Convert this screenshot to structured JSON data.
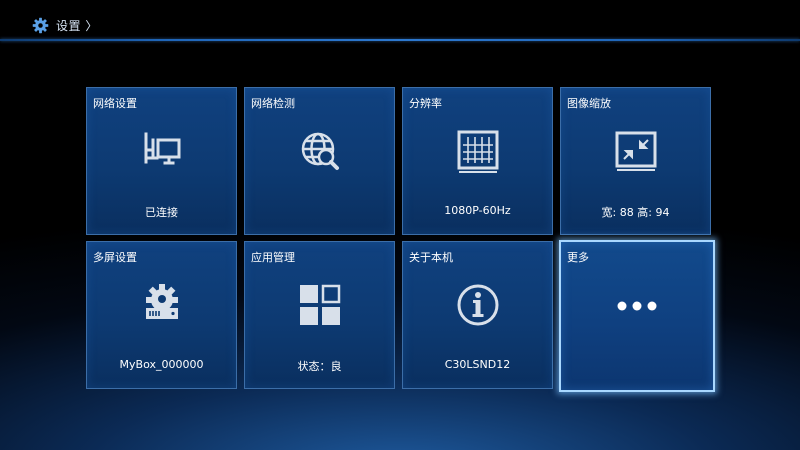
{
  "header": {
    "title": "设置 〉",
    "icon": "gear-icon"
  },
  "tiles": [
    {
      "title": "网络设置",
      "status": "已连接",
      "icon": "ethernet-network-icon"
    },
    {
      "title": "网络检测",
      "status": "",
      "icon": "globe-search-icon"
    },
    {
      "title": "分辨率",
      "status": "1080P-60Hz",
      "icon": "resolution-grid-icon"
    },
    {
      "title": "图像缩放",
      "status": "宽: 88 高: 94",
      "icon": "shrink-arrows-icon"
    },
    {
      "title": "多屏设置",
      "status": "MyBox_000000",
      "icon": "gear-device-icon"
    },
    {
      "title": "应用管理",
      "status": "状态：良",
      "icon": "app-grid-icon"
    },
    {
      "title": "关于本机",
      "status": "C30LSND12",
      "icon": "info-icon"
    },
    {
      "title": "更多",
      "status": "",
      "icon": "more-dots-icon"
    }
  ],
  "selected_tile": "更多",
  "colors": {
    "tile_background": "#0d3a72",
    "tile_border": "#3c6ea8",
    "selected_border": "#a9d8ff",
    "header_line": "#2d78cf",
    "icon_color": "#d8e0ea"
  }
}
